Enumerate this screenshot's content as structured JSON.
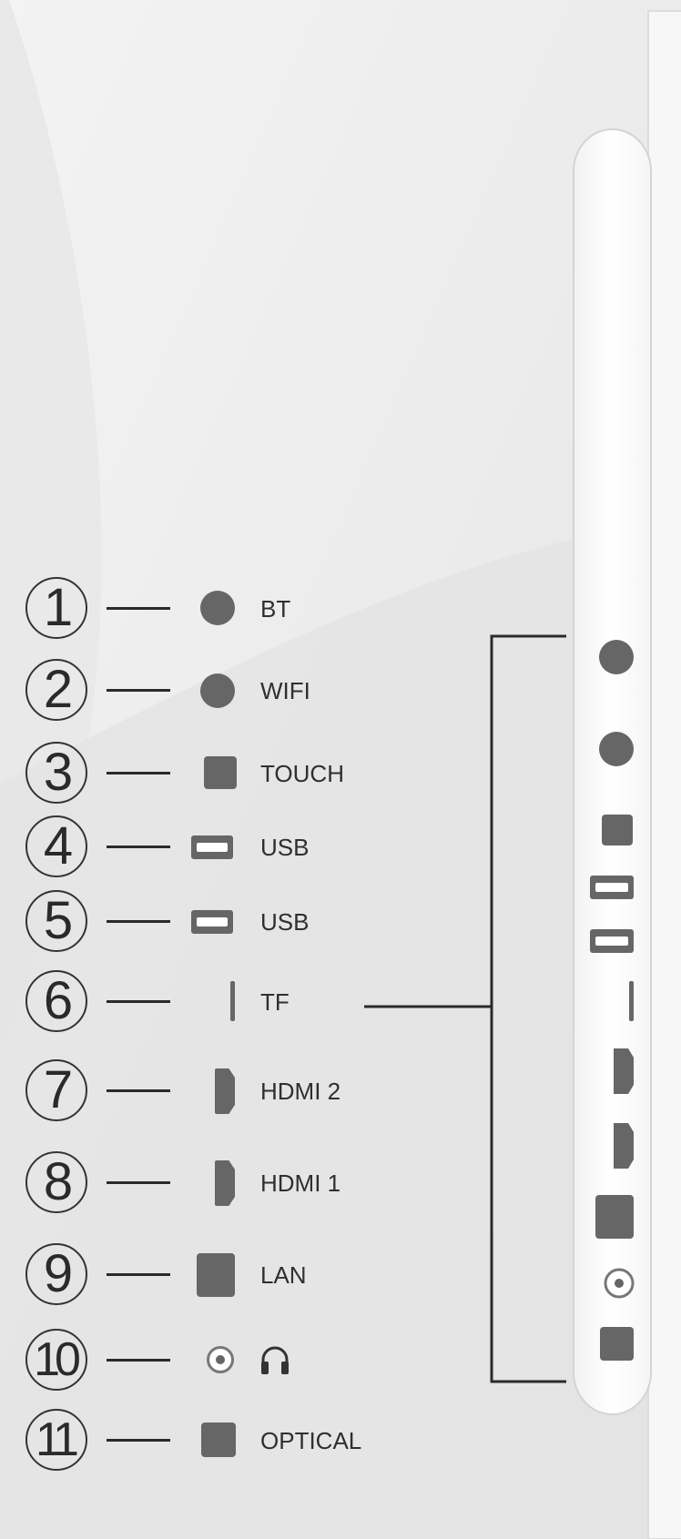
{
  "ports": [
    {
      "num": "1",
      "label": "BT",
      "icon": "circle-icon"
    },
    {
      "num": "2",
      "label": "WIFI",
      "icon": "circle-icon"
    },
    {
      "num": "3",
      "label": "TOUCH",
      "icon": "square-icon"
    },
    {
      "num": "4",
      "label": "USB",
      "icon": "usb-icon"
    },
    {
      "num": "5",
      "label": "USB",
      "icon": "usb-icon"
    },
    {
      "num": "6",
      "label": "TF",
      "icon": "tf-slot-icon"
    },
    {
      "num": "7",
      "label": "HDMI 2",
      "icon": "hdmi-icon"
    },
    {
      "num": "8",
      "label": "HDMI 1",
      "icon": "hdmi-icon"
    },
    {
      "num": "9",
      "label": "LAN",
      "icon": "lan-icon"
    },
    {
      "num": "10",
      "label": "",
      "icon": "headphone-icon"
    },
    {
      "num": "11",
      "label": "OPTICAL",
      "icon": "optical-icon"
    }
  ],
  "colors": {
    "port": "#666666",
    "line": "#2a2a2a",
    "panel": "#ffffff"
  }
}
